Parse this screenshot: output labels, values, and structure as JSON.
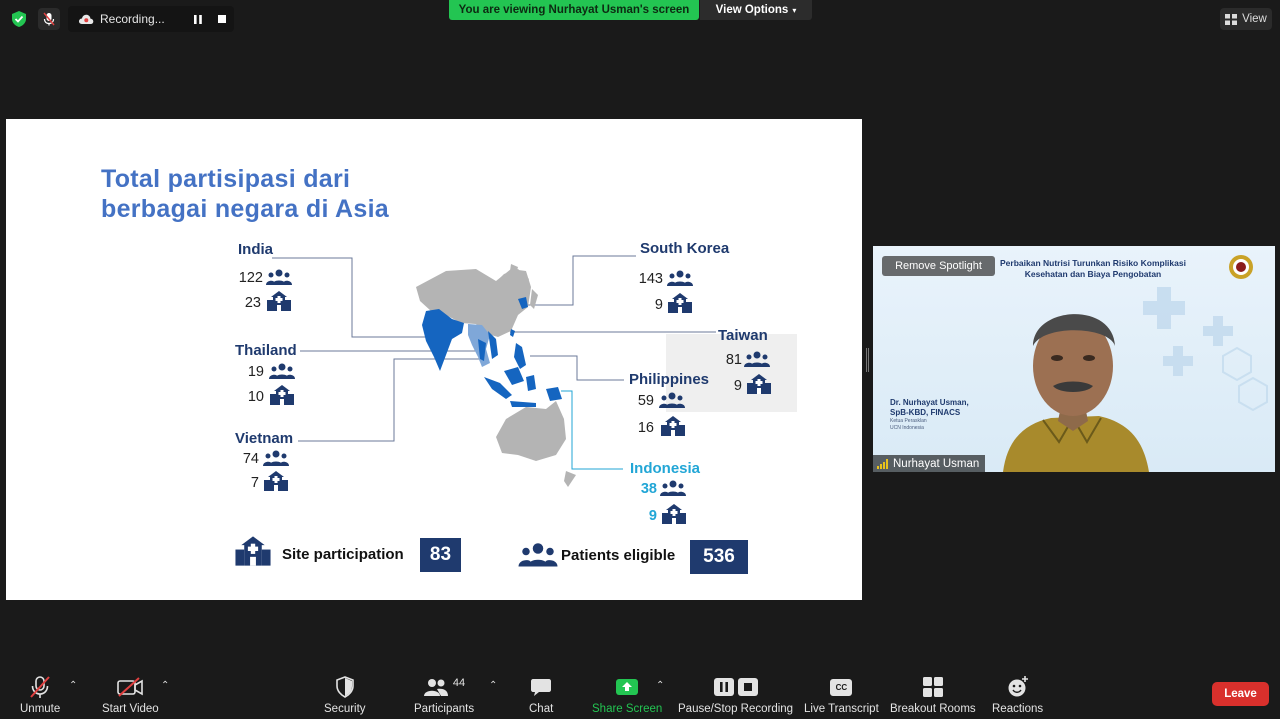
{
  "top_bar": {
    "recording_label": "Recording...",
    "banner_text": "You are viewing Nurhayat Usman's screen",
    "view_options_label": "View Options",
    "view_label": "View"
  },
  "slide": {
    "title_line1": "Total partisipasi dari",
    "title_line2": "berbagai negara di Asia",
    "countries": [
      {
        "name": "India",
        "patients": "122",
        "sites": "23"
      },
      {
        "name": "Thailand",
        "patients": "19",
        "sites": "10"
      },
      {
        "name": "Vietnam",
        "patients": "74",
        "sites": "7"
      },
      {
        "name": "South Korea",
        "patients": "143",
        "sites": "9"
      },
      {
        "name": "Taiwan",
        "patients": "81",
        "sites": "9"
      },
      {
        "name": "Philippines",
        "patients": "59",
        "sites": "16"
      },
      {
        "name": "Indonesia",
        "patients": "38",
        "sites": "9"
      }
    ],
    "site_participation_label": "Site participation",
    "site_participation_value": "83",
    "patients_eligible_label": "Patients eligible",
    "patients_eligible_value": "536",
    "colors": {
      "title": "#4472c4",
      "navy": "#1f3a6e",
      "highlight": "#22a6d6",
      "map_blue": "#1565c0",
      "map_gray": "#b4b4b4"
    }
  },
  "video_tile": {
    "remove_spotlight_label": "Remove Spotlight",
    "header_line1": "Perbaikan Nutrisi Turunkan Risiko Komplikasi",
    "header_line2": "Kesehatan dan Biaya Pengobatan",
    "speaker_name_line1": "Dr. Nurhayat Usman,",
    "speaker_name_line2": "SpB-KBD, FINACS",
    "speaker_sub_line1": "Ketua Perasklan",
    "speaker_sub_line2": "UCN Indonesia",
    "participant_name": "Nurhayat Usman"
  },
  "toolbar": {
    "unmute": "Unmute",
    "start_video": "Start Video",
    "security": "Security",
    "participants": "Participants",
    "participants_count": "44",
    "chat": "Chat",
    "share_screen": "Share Screen",
    "pause_stop_recording": "Pause/Stop Recording",
    "live_transcript": "Live Transcript",
    "breakout_rooms": "Breakout Rooms",
    "reactions": "Reactions",
    "leave": "Leave",
    "cc_icon_text": "CC"
  }
}
